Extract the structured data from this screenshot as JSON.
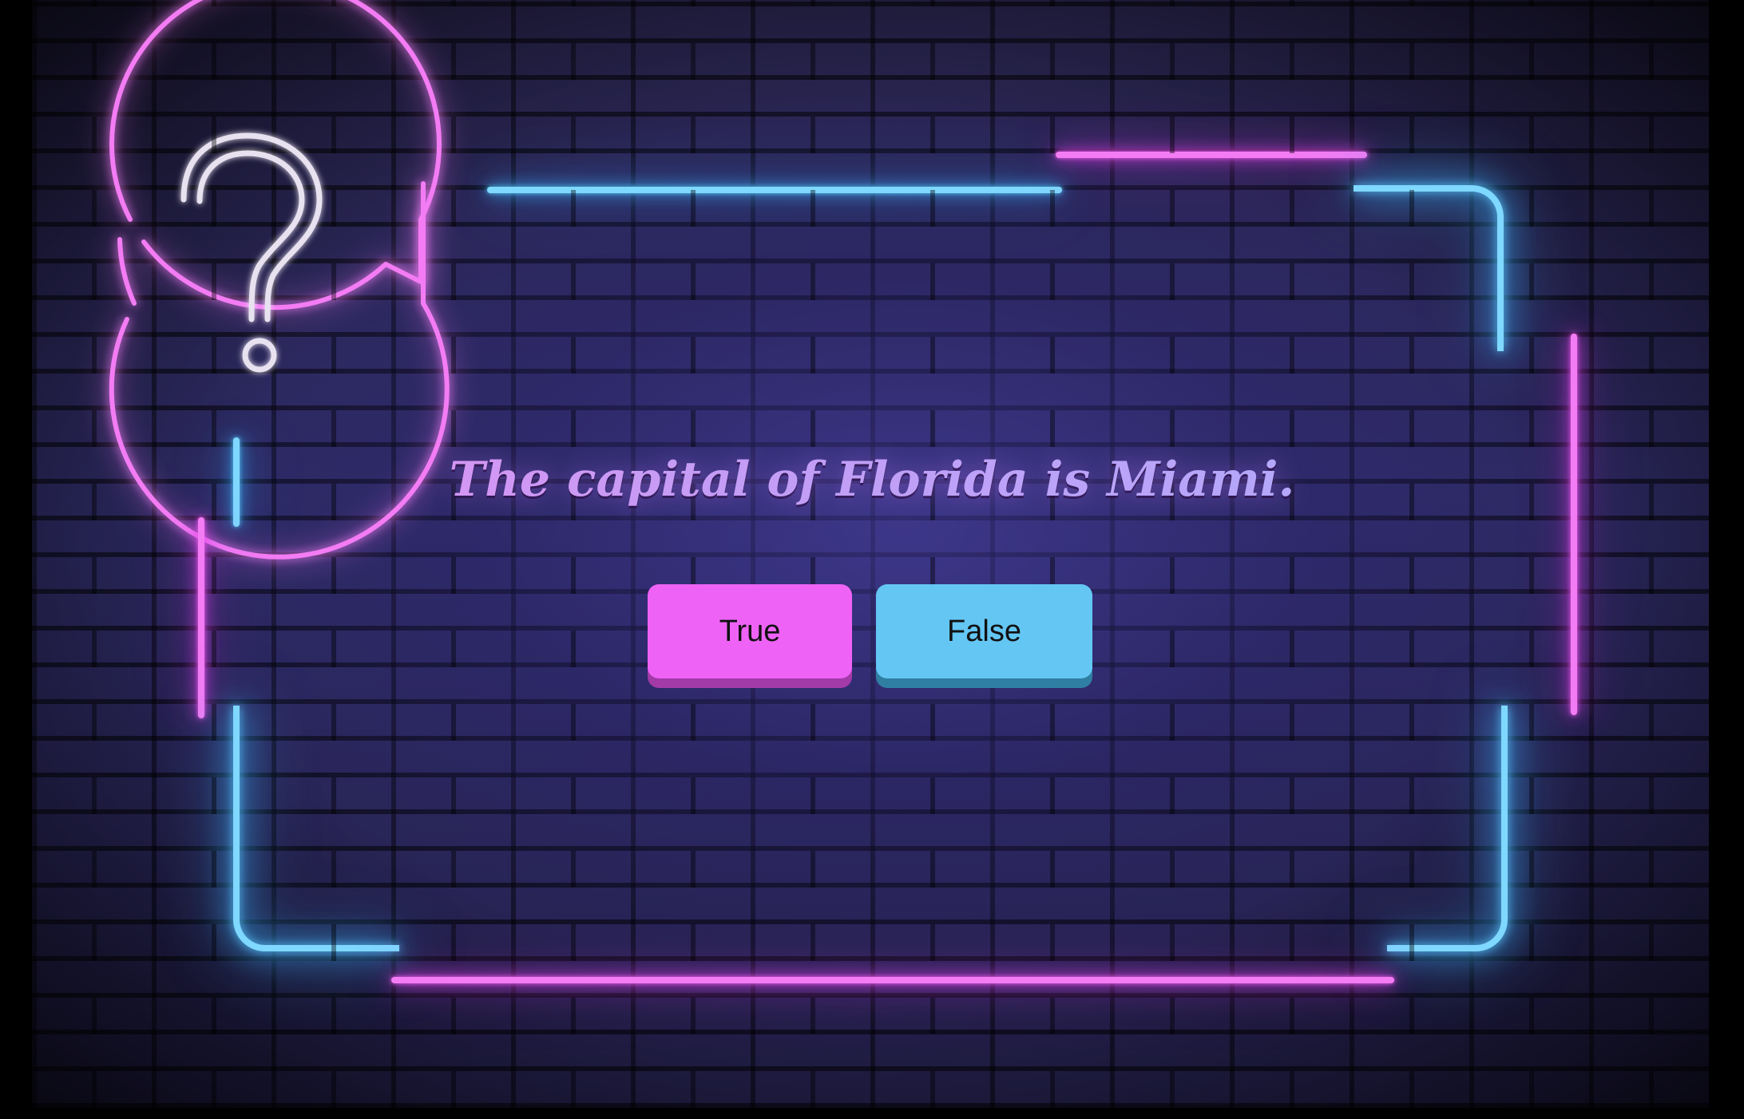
{
  "question": {
    "text": "The capital of Florida is Miami."
  },
  "answers": {
    "true_label": "True",
    "false_label": "False"
  },
  "colors": {
    "neon_pink": "#f37cf4",
    "neon_blue": "#7fd8ff",
    "true_button": "#ee63f5",
    "false_button": "#64c6f3",
    "brick_wall": "#2d2a63"
  },
  "decor": {
    "badge_icon": "question-mark-speech-bubble-icon"
  }
}
